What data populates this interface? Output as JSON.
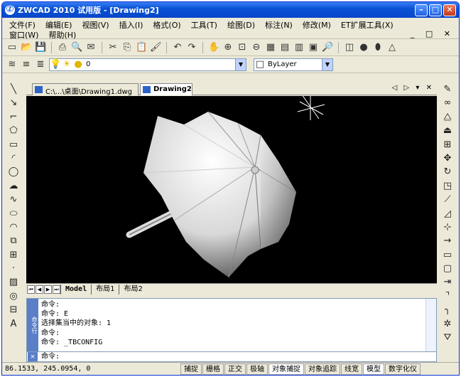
{
  "window": {
    "title": "ZWCAD 2010 试用版 - [Drawing2]"
  },
  "menu": {
    "row1": [
      "文件(F)",
      "编辑(E)",
      "视图(V)",
      "插入(I)",
      "格式(O)",
      "工具(T)",
      "绘图(D)",
      "标注(N)",
      "修改(M)",
      "ET扩展工具(X)"
    ],
    "row2": [
      "窗口(W)",
      "帮助(H)"
    ]
  },
  "layer_combo": {
    "value": "0"
  },
  "linetype_combo": {
    "value": "ByLayer"
  },
  "doc_tabs": [
    "C:\\...\\桌面\\Drawing1.dwg",
    "Drawing2"
  ],
  "layout_tabs": [
    "Model",
    "布局1",
    "布局2"
  ],
  "command_lines": [
    "命令:",
    "命令: E",
    "选择集当中的对象: 1",
    "命令:",
    "命令: _TBCONFIG"
  ],
  "command_side": "命令行",
  "command_prompt": "命令:",
  "status": {
    "coords": "86.1533, 245.0954, 0",
    "buttons": [
      "捕捉",
      "栅格",
      "正交",
      "极轴",
      "对象捕捉",
      "对象追踪",
      "线宽",
      "模型",
      "数字化仪"
    ]
  },
  "colors": {
    "accent": "#0a53d6",
    "canvas": "#000000"
  }
}
